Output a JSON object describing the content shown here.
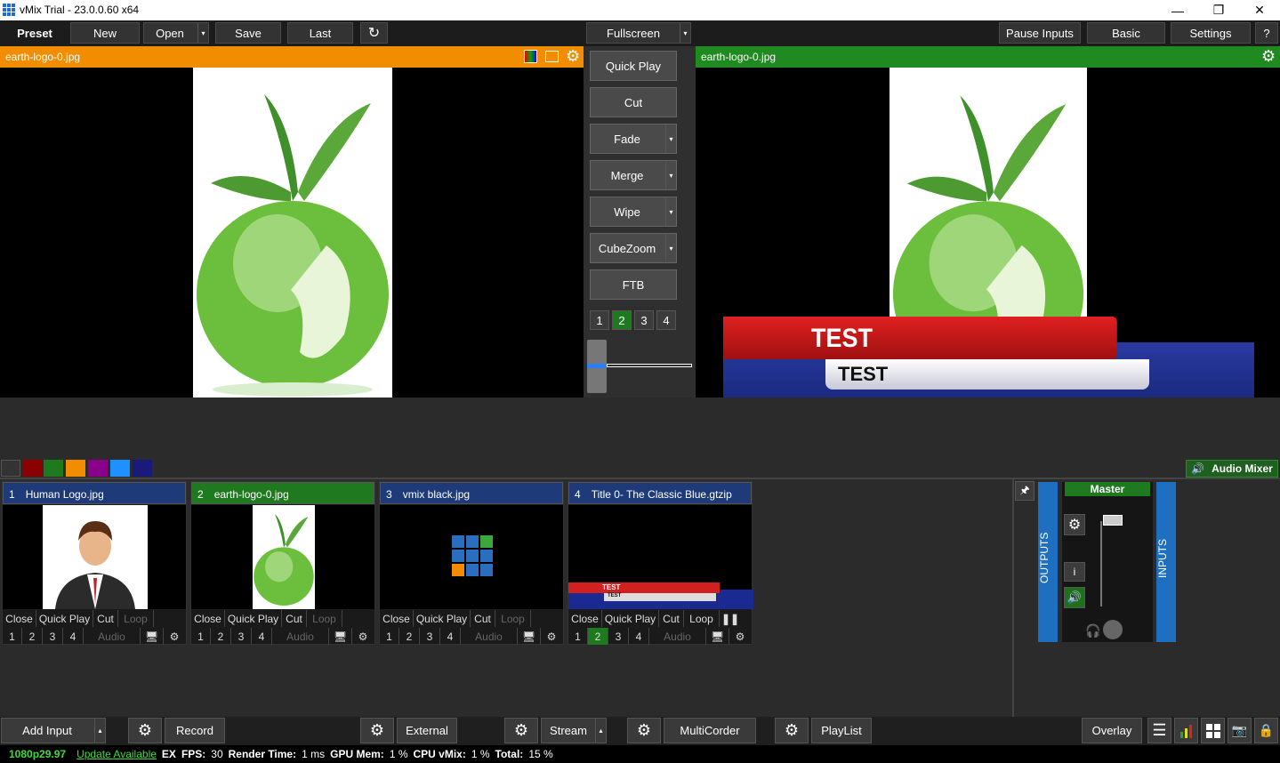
{
  "window": {
    "title": "vMix Trial - 23.0.0.60 x64"
  },
  "toolbar": {
    "preset": "Preset",
    "new": "New",
    "open": "Open",
    "save": "Save",
    "last": "Last",
    "fullscreen": "Fullscreen",
    "pause_inputs": "Pause Inputs",
    "basic": "Basic",
    "settings": "Settings",
    "help": "?"
  },
  "preview": {
    "title": "earth-logo-0.jpg"
  },
  "program": {
    "title": "earth-logo-0.jpg",
    "lower_third_top": "TEST",
    "lower_third_bottom": "TEST"
  },
  "transitions": {
    "quick_play": "Quick Play",
    "cut": "Cut",
    "fade": "Fade",
    "merge": "Merge",
    "wipe": "Wipe",
    "cubezoom": "CubeZoom",
    "ftb": "FTB",
    "nums": [
      "1",
      "2",
      "3",
      "4"
    ]
  },
  "audio_mixer": {
    "label": "Audio Mixer",
    "master": "Master",
    "outputs": "OUTPUTS",
    "inputs": "INPUTS"
  },
  "inputs": [
    {
      "num": "1",
      "name": "Human Logo.jpg",
      "close": "Close",
      "quick_play": "Quick Play",
      "cut": "Cut",
      "loop": "Loop",
      "audio": "Audio"
    },
    {
      "num": "2",
      "name": "earth-logo-0.jpg",
      "close": "Close",
      "quick_play": "Quick Play",
      "cut": "Cut",
      "loop": "Loop",
      "audio": "Audio"
    },
    {
      "num": "3",
      "name": "vmix black.jpg",
      "close": "Close",
      "quick_play": "Quick Play",
      "cut": "Cut",
      "loop": "Loop",
      "audio": "Audio"
    },
    {
      "num": "4",
      "name": "Title 0- The Classic Blue.gtzip",
      "close": "Close",
      "quick_play": "Quick Play",
      "cut": "Cut",
      "loop": "Loop",
      "audio": "Audio",
      "title_top": "TEST",
      "title_bottom": "TEST"
    }
  ],
  "bottom": {
    "add_input": "Add Input",
    "record": "Record",
    "external": "External",
    "stream": "Stream",
    "multicorder": "MultiCorder",
    "playlist": "PlayList",
    "overlay": "Overlay"
  },
  "status": {
    "format": "1080p29.97",
    "update": "Update Available",
    "ex": "EX",
    "fps_label": "FPS:",
    "fps": "30",
    "render_label": "Render Time:",
    "render": "1 ms",
    "gpu_label": "GPU Mem:",
    "gpu": "1 %",
    "cpu_label": "CPU vMix:",
    "cpu": "1 %",
    "total_label": "Total:",
    "total": "15 %"
  },
  "colors": {
    "preview": "#f28c00",
    "program": "#1f8a1f",
    "tab_colors": [
      "#333333",
      "#8b0000",
      "#1f7a1f",
      "#f28c00",
      "#8b008b",
      "#1e90ff",
      "#1a1a7a"
    ]
  }
}
